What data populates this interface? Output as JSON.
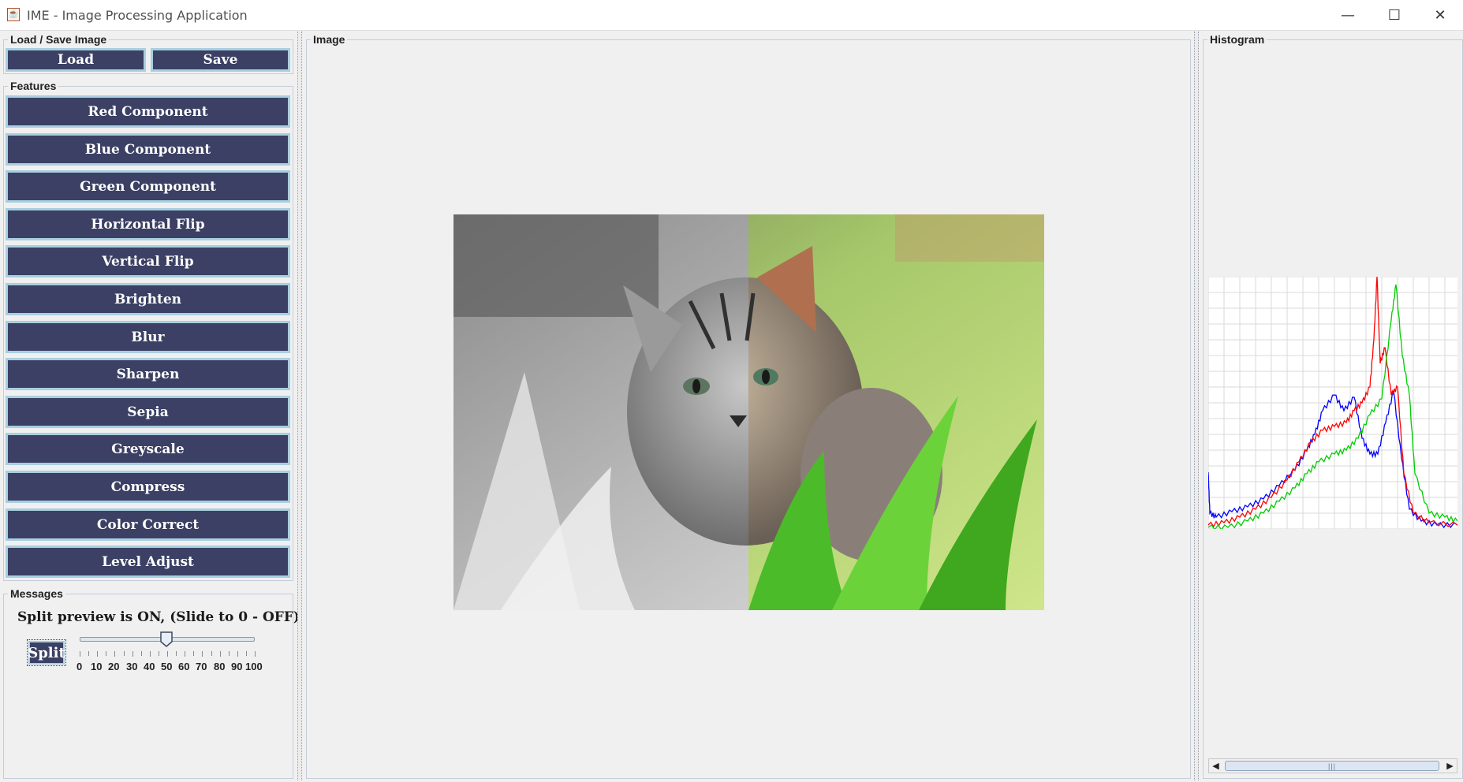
{
  "window": {
    "title": "IME - Image Processing Application",
    "app_icon": "java-cup-icon",
    "controls": {
      "minimize": "—",
      "maximize": "☐",
      "close": "✕"
    }
  },
  "load_save": {
    "title": "Load / Save Image",
    "load_label": "Load",
    "save_label": "Save"
  },
  "features": {
    "title": "Features",
    "buttons": [
      "Red Component",
      "Blue Component",
      "Green Component",
      "Horizontal Flip",
      "Vertical Flip",
      "Brighten",
      "Blur",
      "Sharpen",
      "Sepia",
      "Greyscale",
      "Compress",
      "Color Correct",
      "Level Adjust"
    ]
  },
  "messages": {
    "title": "Messages",
    "text": "Split preview is ON, (Slide to 0 - OFF)",
    "split_label": "Split",
    "slider": {
      "min": 0,
      "max": 100,
      "value": 50,
      "labels": [
        "0",
        "10",
        "20",
        "30",
        "40",
        "50",
        "60",
        "70",
        "80",
        "90",
        "100"
      ]
    }
  },
  "image_panel": {
    "title": "Image",
    "image_desc": "kitten-in-grass"
  },
  "histogram_panel": {
    "title": "Histogram",
    "scroll_thumb_glyph": "|||",
    "scroll_left": "◀",
    "scroll_right": "▶",
    "colors": {
      "red": "#ff0000",
      "green": "#00cc00",
      "blue": "#0000ff",
      "grid": "#d9d9d9"
    }
  }
}
